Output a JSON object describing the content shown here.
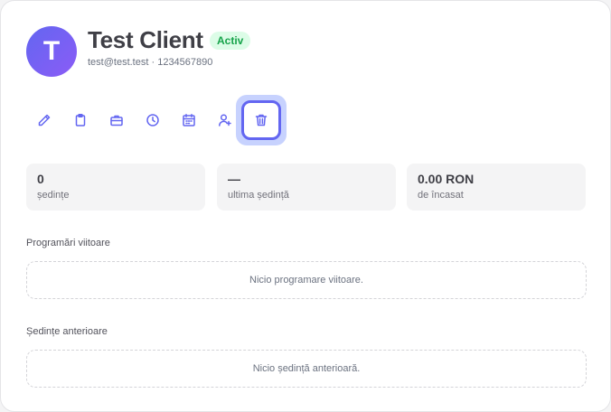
{
  "client": {
    "initial": "T",
    "name": "Test Client",
    "status": "Activ",
    "email": "test@test.test",
    "separator": " · ",
    "phone": "1234567890"
  },
  "toolbar": {
    "icons": [
      "edit-icon",
      "clipboard-icon",
      "briefcase-icon",
      "clock-icon",
      "calendar-icon",
      "user-add-icon",
      "trash-icon"
    ],
    "active": "trash-icon"
  },
  "stats": [
    {
      "value": "0",
      "label": "ședințe"
    },
    {
      "value": "—",
      "label": "ultima ședință"
    },
    {
      "value": "0.00 RON",
      "label": "de încasat"
    }
  ],
  "upcoming": {
    "title": "Programări viitoare",
    "empty": "Nicio programare viitoare."
  },
  "past": {
    "title": "Ședințe anterioare",
    "empty": "Nicio ședință anterioară."
  },
  "colors": {
    "accent": "#6366f1",
    "badge_bg": "#dcfce7",
    "badge_text": "#16a34a"
  }
}
